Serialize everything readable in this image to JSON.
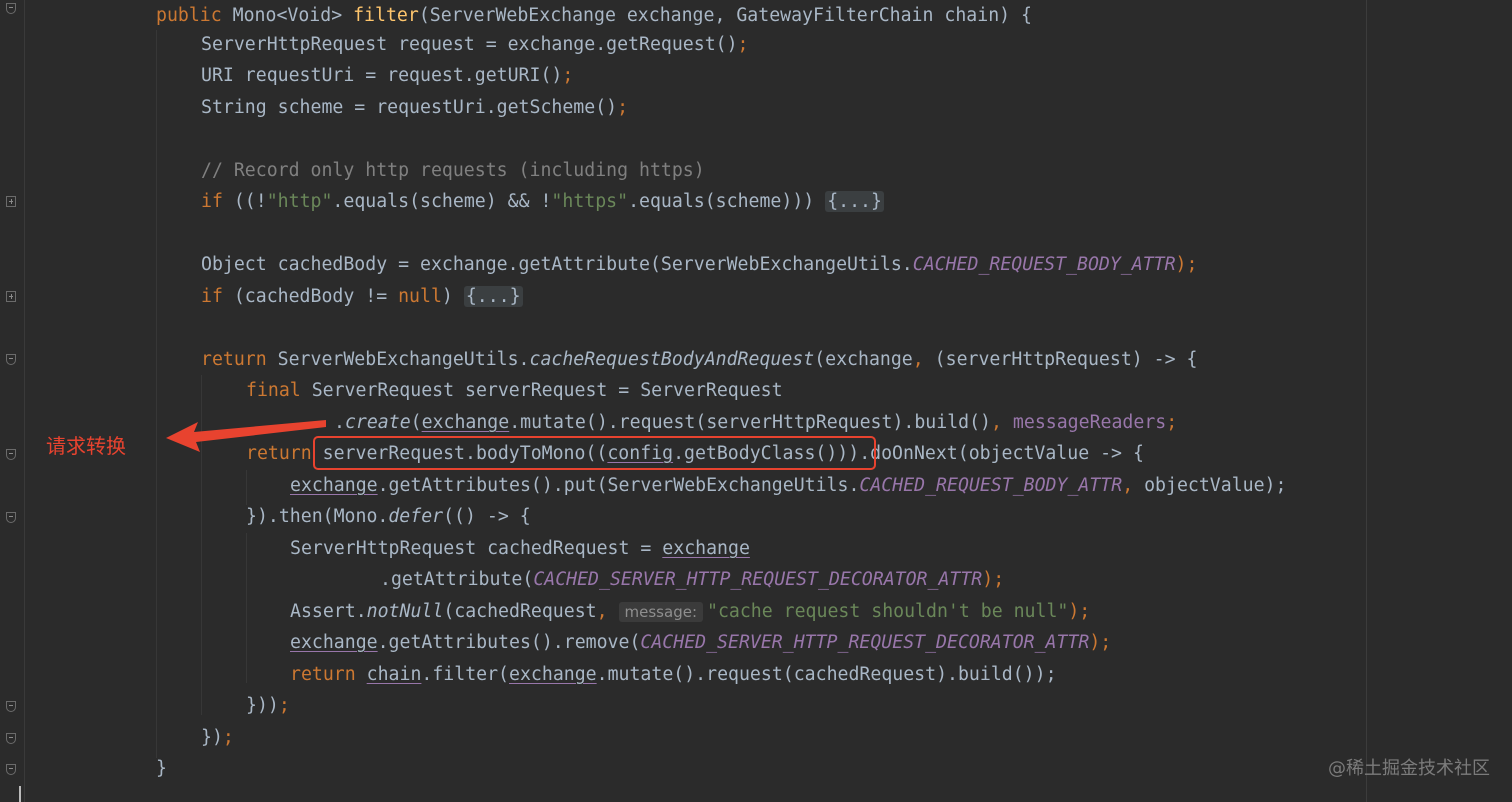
{
  "code_lines": [
    "public Mono<Void> filter(ServerWebExchange exchange, GatewayFilterChain chain) {",
    "ServerHttpRequest request = exchange.getRequest();",
    "URI requestUri = request.getURI();",
    "String scheme = requestUri.getScheme();",
    "",
    "// Record only http requests (including https)",
    "if ((!\"http\".equals(scheme) && !\"https\".equals(scheme))) {...}",
    "",
    "Object cachedBody = exchange.getAttribute(ServerWebExchangeUtils.CACHED_REQUEST_BODY_ATTR);",
    "if (cachedBody != null) {...}",
    "",
    "return ServerWebExchangeUtils.cacheRequestBodyAndRequest(exchange, (serverHttpRequest) -> {",
    "final ServerRequest serverRequest = ServerRequest",
    ".create(exchange.mutate().request(serverHttpRequest).build(), messageReaders);",
    "return serverRequest.bodyToMono((config.getBodyClass())).doOnNext(objectValue -> {",
    "exchange.getAttributes().put(ServerWebExchangeUtils.CACHED_REQUEST_BODY_ATTR, objectValue);",
    "}).then(Mono.defer(() -> {",
    "ServerHttpRequest cachedRequest = exchange",
    ".getAttribute(CACHED_SERVER_HTTP_REQUEST_DECORATOR_ATTR);",
    "Assert.notNull(cachedRequest, message: \"cache request shouldn't be null\");",
    "exchange.getAttributes().remove(CACHED_SERVER_HTTP_REQUEST_DECORATOR_ATTR);",
    "return chain.filter(exchange.mutate().request(cachedRequest).build());",
    "}));",
    "});",
    "}"
  ],
  "tokens": {
    "public": "public",
    "mono_void": "Mono<Void>",
    "filter": "filter",
    "sig_rest": "(ServerWebExchange exchange, GatewayFilterChain chain) {",
    "l2": "ServerHttpRequest request = exchange.getRequest()",
    "l3": "URI requestUri = request.getURI()",
    "l4": "String scheme = requestUri.getScheme()",
    "semi": ";",
    "comment": "// Record only http requests (including https)",
    "if": "if",
    "l6a": " ((!",
    "http": "\"http\"",
    "l6b": ".equals(scheme) && !",
    "https": "\"https\"",
    "l6c": ".equals(scheme))) ",
    "folded": "{...}",
    "l8a": "Object cachedBody = exchange.getAttribute(ServerWebExchangeUtils.",
    "cached_body_attr": "CACHED_REQUEST_BODY_ATTR",
    "l8b": ");",
    "l9a": " (cachedBody != ",
    "null": "null",
    "l9b": ") ",
    "return": "return",
    "l11a": " ServerWebExchangeUtils.",
    "cache_fn": "cacheRequestBodyAndRequest",
    "l11b": "(exchange",
    "comma": ",",
    "l11c": " (serverHttpRequest) -> {",
    "final": "final",
    "l12": " ServerRequest serverRequest = ServerRequest",
    "dot": ".",
    "create": "create",
    "paren_open": "(",
    "exchange": "exchange",
    "l13a": ".mutate().request(serverHttpRequest).build()",
    "message_readers": "messageReaders",
    "l13b": ");",
    "l14a": " serverRequest.bodyToMono((",
    "config": "config",
    "l14b": ".getBodyClass())).doOnNext(objectValue -> {",
    "l15a": ".getAttributes().put(ServerWebExchangeUtils.",
    "l15b": " objectValue);",
    "l16a": "}).then(Mono.",
    "defer": "defer",
    "l16b": "(() -> {",
    "l17": "ServerHttpRequest cachedRequest = ",
    "l18a": ".getAttribute(",
    "decorator_attr": "CACHED_SERVER_HTTP_REQUEST_DECORATOR_ATTR",
    "l18b": ");",
    "l19a": "Assert.",
    "not_null": "notNull",
    "l19b": "(cachedRequest",
    "hint_message": "message:",
    "msg_str": "\"cache request shouldn't be null\"",
    "l19c": ");",
    "l20a": ".getAttributes().remove(",
    "l20b": ");",
    "chain": "chain",
    "l21a": ".filter(",
    "l21b": ".mutate().request(cachedRequest).build());",
    "l22": "}))",
    "l23": "})",
    "l24": "}"
  },
  "annotation": {
    "label": "请求转换",
    "color": "#e8432f"
  },
  "watermark": "@稀土掘金技术社区",
  "colors": {
    "background": "#2b2b2b",
    "keyword": "#cc7832",
    "function": "#ffc66d",
    "string": "#6a8759",
    "comment": "#808080",
    "constant": "#9876aa",
    "text": "#a9b7c6"
  }
}
